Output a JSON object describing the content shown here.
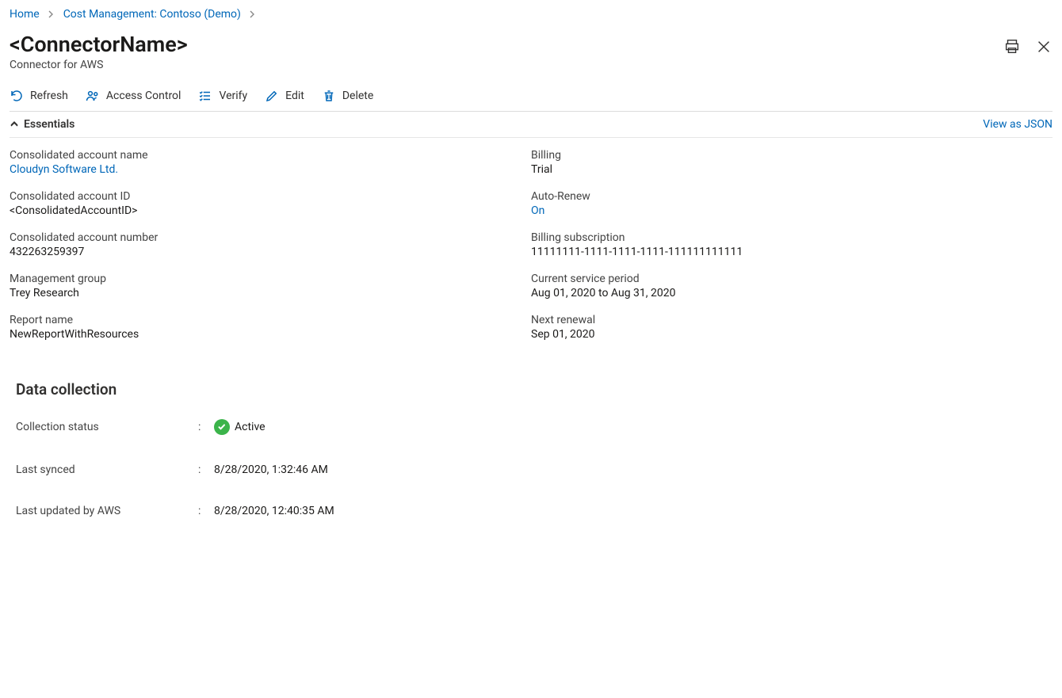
{
  "breadcrumbs": {
    "items": [
      "Home",
      "Cost Management: Contoso (Demo)"
    ]
  },
  "header": {
    "title": "<ConnectorName>",
    "subtitle": "Connector for AWS"
  },
  "toolbar": {
    "refresh_label": "Refresh",
    "access_control_label": "Access Control",
    "verify_label": "Verify",
    "edit_label": "Edit",
    "delete_label": "Delete"
  },
  "essentials": {
    "header": "Essentials",
    "view_json_label": "View as JSON",
    "left": [
      {
        "label": "Consolidated account name",
        "value": "Cloudyn Software Ltd.",
        "is_link": true
      },
      {
        "label": "Consolidated account ID",
        "value": "<ConsolidatedAccountID>",
        "is_link": false
      },
      {
        "label": "Consolidated account number",
        "value": "432263259397",
        "is_link": false
      },
      {
        "label": "Management group",
        "value": "Trey Research",
        "is_link": false
      },
      {
        "label": "Report name",
        "value": "NewReportWithResources",
        "is_link": false
      }
    ],
    "right": [
      {
        "label": "Billing",
        "value": "Trial",
        "is_link": false
      },
      {
        "label": "Auto-Renew",
        "value": "On",
        "is_link": true
      },
      {
        "label": "Billing subscription",
        "value": "11111111-1111-1111-1111-111111111111",
        "is_link": false
      },
      {
        "label": "Current service period",
        "value": "Aug 01, 2020 to Aug 31, 2020",
        "is_link": false
      },
      {
        "label": "Next renewal",
        "value": "Sep 01, 2020",
        "is_link": false
      }
    ]
  },
  "data_collection": {
    "title": "Data collection",
    "rows": [
      {
        "label": "Collection status",
        "value": "Active",
        "status_icon": true
      },
      {
        "label": "Last synced",
        "value": "8/28/2020, 1:32:46 AM",
        "status_icon": false
      },
      {
        "label": "Last updated by AWS",
        "value": "8/28/2020, 12:40:35 AM",
        "status_icon": false
      }
    ]
  }
}
